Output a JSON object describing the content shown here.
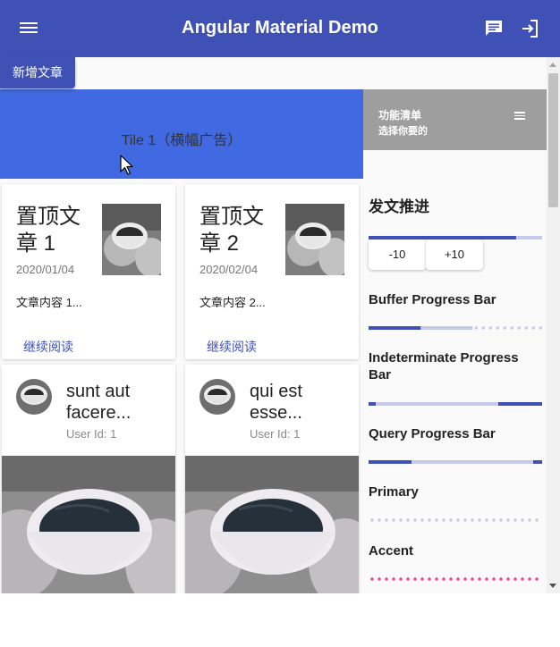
{
  "app": {
    "title": "Angular Material Demo",
    "primary_color": "#3f51b5",
    "banner_color": "#4169e1",
    "accent_color": "#ff4081"
  },
  "toolbar": {
    "menu_icon": "menu-icon",
    "chat_icon": "chat-icon",
    "logout_icon": "logout-icon"
  },
  "actions": {
    "add_article": "新增文章"
  },
  "banner": {
    "text": "Tile 1（横幅广告）"
  },
  "sidebar_header": {
    "line1": "功能清单",
    "line2": "选择你要的",
    "icon": "list-icon"
  },
  "articles": [
    {
      "title": "置顶文章 1",
      "date": "2020/01/04",
      "content": "文章内容 1...",
      "read_more": "继续阅读"
    },
    {
      "title": "置顶文章 2",
      "date": "2020/02/04",
      "content": "文章内容 2...",
      "read_more": "继续阅读"
    }
  ],
  "posts": [
    {
      "title": "sunt aut facere...",
      "user": "User Id: 1"
    },
    {
      "title": "qui est esse...",
      "user": "User Id: 1"
    }
  ],
  "progress": {
    "title": "发文推进",
    "value_percent": 85,
    "minus_label": "-10",
    "plus_label": "+10",
    "buffer_title": "Buffer Progress Bar",
    "buffer_value": 30,
    "buffer_buffer": 60,
    "indeterminate_title": "Indeterminate Progress Bar",
    "query_title": "Query Progress Bar",
    "primary_title": "Primary",
    "accent_title": "Accent"
  }
}
